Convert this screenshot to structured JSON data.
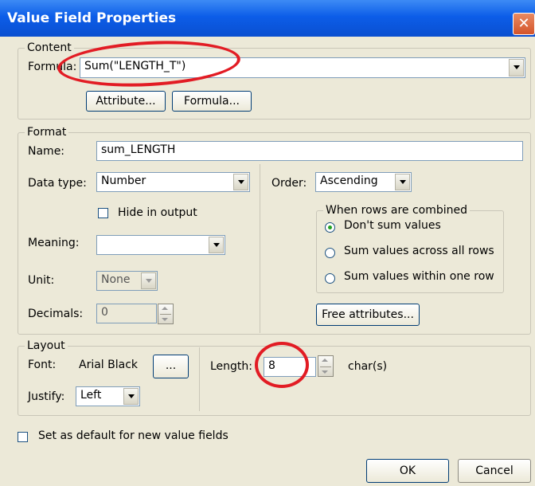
{
  "dialog": {
    "title": "Value Field Properties",
    "close_glyph": "✕",
    "content": {
      "legend": "Content",
      "formula_label": "Formula:",
      "formula_value": "Sum(\"LENGTH_T\")",
      "attribute_button": "Attribute...",
      "formula_button": "Formula..."
    },
    "format": {
      "legend": "Format",
      "name_label": "Name:",
      "name_value": "sum_LENGTH",
      "data_type_label": "Data type:",
      "data_type_value": "Number",
      "hide_in_output_label": "Hide in output",
      "hide_in_output_checked": false,
      "meaning_label": "Meaning:",
      "meaning_value": "",
      "unit_label": "Unit:",
      "unit_value": "None",
      "decimals_label": "Decimals:",
      "decimals_value": "0",
      "order_label": "Order:",
      "order_value": "Ascending",
      "combine_group_label": "When rows are combined",
      "combine_options": [
        {
          "label": "Don't sum values",
          "selected": true
        },
        {
          "label": "Sum values across all rows",
          "selected": false
        },
        {
          "label": "Sum values within one row",
          "selected": false
        }
      ],
      "free_attributes_button": "Free attributes..."
    },
    "layout": {
      "legend": "Layout",
      "font_label": "Font:",
      "font_value": "Arial Black",
      "font_button": "...",
      "justify_label": "Justify:",
      "justify_value": "Left",
      "length_label": "Length:",
      "length_value": "8",
      "length_unit": "char(s)"
    },
    "default_checkbox_label": "Set as default for new value fields",
    "default_checked": false,
    "ok_button": "OK",
    "cancel_button": "Cancel"
  },
  "colors": {
    "annotation": "#e21c24",
    "dialog_bg": "#ece9d8",
    "titlebar": "#0a4fd0"
  }
}
